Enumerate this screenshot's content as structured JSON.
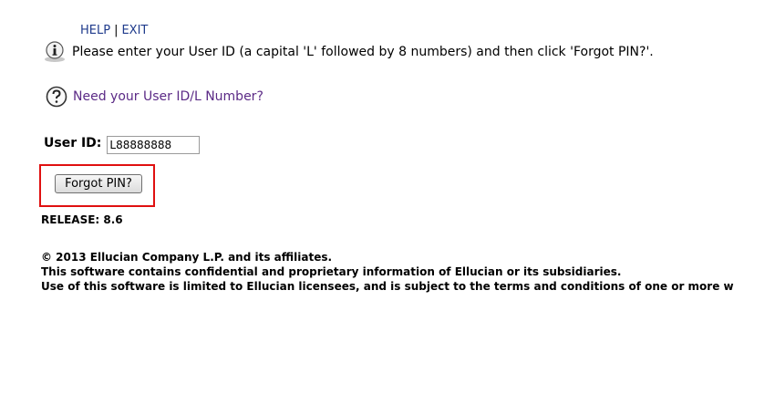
{
  "topnav": {
    "help": "HELP",
    "separator": "|",
    "exit": "EXIT"
  },
  "info": {
    "icon": "info-icon",
    "text": "Please enter your User ID (a capital 'L' followed by 8 numbers) and then click 'Forgot PIN?'."
  },
  "help_link": {
    "icon": "question-icon",
    "text": "Need your User ID/L Number?"
  },
  "form": {
    "userid_label": "User ID:",
    "userid_value": "L88888888",
    "forgot_button": "Forgot PIN?"
  },
  "release": "RELEASE: 8.6",
  "footer": {
    "line1": "© 2013 Ellucian Company L.P. and its affiliates.",
    "line2": "This software contains confidential and proprietary information of Ellucian or its subsidiaries.",
    "line3": "Use of this software is limited to Ellucian licensees, and is subject to the terms and conditions of one or more w"
  },
  "colors": {
    "link": "#1f3b8c",
    "help_link": "#5b2a86",
    "highlight": "#e01010"
  }
}
